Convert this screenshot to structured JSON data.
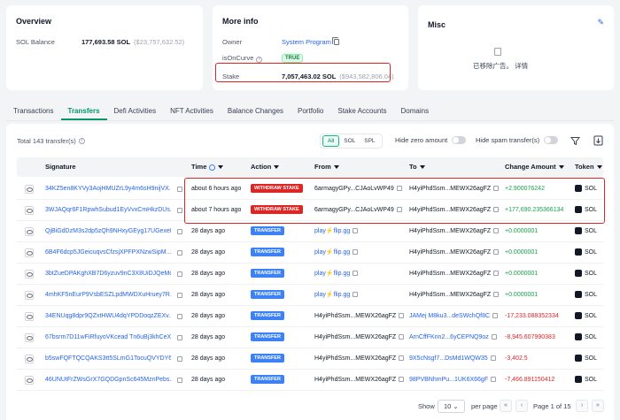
{
  "overview": {
    "title": "Overview",
    "sol_balance_label": "SOL Balance",
    "sol_balance_value": "177,693.58 SOL",
    "sol_balance_usd": "($23,757,632.52)"
  },
  "more_info": {
    "title": "More info",
    "owner_label": "Owner",
    "owner_value": "System Program",
    "is_on_curve_label": "isOnCurve",
    "is_on_curve_value": "TRUE",
    "stake_label": "Stake",
    "stake_value": "7,057,463.02 SOL",
    "stake_usd": "($943,582,806.04)"
  },
  "misc": {
    "title": "Misc",
    "ad_text": "已移除广告。 详情"
  },
  "tabs": [
    "Transactions",
    "Transfers",
    "Defi Activities",
    "NFT Activities",
    "Balance Changes",
    "Portfolio",
    "Stake Accounts",
    "Domains"
  ],
  "toolbar": {
    "total": "Total 143 transfer(s)",
    "seg_all": "All",
    "seg_sol": "SOL",
    "seg_spl": "SPL",
    "hide_zero": "Hide zero amount",
    "hide_spam": "Hide spam transfer(s)"
  },
  "columns": {
    "signature": "Signature",
    "time": "Time",
    "action": "Action",
    "from": "From",
    "to": "To",
    "change": "Change Amount",
    "token": "Token"
  },
  "rows": [
    {
      "sig": "34KZ5en8KYVy3AojHMUZrL9y4m6sH9nijVX...",
      "time": "about 6 hours ago",
      "action": "WITHDRAW STAKE",
      "from": "6armagyGPy...CJAoLvWP49",
      "to": "H4yiPhdSsm...MEWX26agFZ",
      "change": "+2.900076242",
      "dir": "pos",
      "token": "SOL"
    },
    {
      "sig": "3WJAQqr6F1RpwhSubud1EyVvxCmHkzDUs...",
      "time": "about 7 hours ago",
      "action": "WITHDRAW STAKE",
      "from": "6armagyGPy...CJAoLvWP49",
      "to": "H4yiPhdSsm...MEWX26agFZ",
      "change": "+177,690.235366134",
      "dir": "pos",
      "token": "SOL"
    },
    {
      "sig": "QjBiGdDzM3s2dp5zQh9NHxyGEyg17UGexeD...",
      "time": "28 days ago",
      "action": "TRANSFER",
      "from": "play⚡flip.gg",
      "to": "H4yiPhdSsm...MEWX26agFZ",
      "change": "+0.0000001",
      "dir": "pos",
      "token": "SOL"
    },
    {
      "sig": "6B4F6dcp5JGeicuqvsCfzsjXPFPXNzwSipM...",
      "time": "28 days ago",
      "action": "TRANSFER",
      "from": "play⚡flip.gg",
      "to": "H4yiPhdSsm...MEWX26agFZ",
      "change": "+0.0000001",
      "dir": "pos",
      "token": "SOL"
    },
    {
      "sig": "3btZueDPAKghXB7D6yzuv9nC3X8UiDJQeMq...",
      "time": "28 days ago",
      "action": "TRANSFER",
      "from": "play⚡flip.gg",
      "to": "H4yiPhdSsm...MEWX26agFZ",
      "change": "+0.0000001",
      "dir": "pos",
      "token": "SOL"
    },
    {
      "sig": "4mhKF5nEurP9VsbESZLpdMWDXuHruey7R...",
      "time": "28 days ago",
      "action": "TRANSFER",
      "from": "play⚡flip.gg",
      "to": "H4yiPhdSsm...MEWX26agFZ",
      "change": "+0.0000001",
      "dir": "pos",
      "token": "SOL"
    },
    {
      "sig": "34ENUqg8dpr9QZxtHWU4dqYPDDoqzZEXv...",
      "time": "28 days ago",
      "action": "TRANSFER",
      "from": "H4yiPhdSsm...MEWX26agFZ",
      "to": "JAMej M8ku3...deSWchQf8C",
      "change": "-17,233.088352334",
      "dir": "neg",
      "token": "SOL"
    },
    {
      "sig": "67bsrm7D11wFiRfuyoVKcead Tn6uBj3khCeX...",
      "time": "28 days ago",
      "action": "TRANSFER",
      "from": "H4yiPhdSsm...MEWX26agFZ",
      "to": "ArnCffFKnn2...6yCEPNQ9oz",
      "change": "-8,945.607990383",
      "dir": "neg",
      "token": "SOL"
    },
    {
      "sig": "b5swFQFTQCQAKS3tt5SLmG1TocuQVYDY6...",
      "time": "28 days ago",
      "action": "TRANSFER",
      "from": "H4yiPhdSsm...MEWX26agFZ",
      "to": "9X5cNsgf7...DsMd1WQW35",
      "change": "-3,402.5",
      "dir": "neg",
      "token": "SOL"
    },
    {
      "sig": "46UNUtFrZWsGrX7GQDGpnSc645MznPebs...",
      "time": "28 days ago",
      "action": "TRANSFER",
      "from": "H4yiPhdSsm...MEWX26agFZ",
      "to": "98PVBNhmPu...1UK6X66gF",
      "change": "-7,466.891150412",
      "dir": "neg",
      "token": "SOL"
    }
  ],
  "pager": {
    "show_label": "Show",
    "page_size": "10",
    "per_page": "per page",
    "page_text": "Page 1 of 15"
  }
}
